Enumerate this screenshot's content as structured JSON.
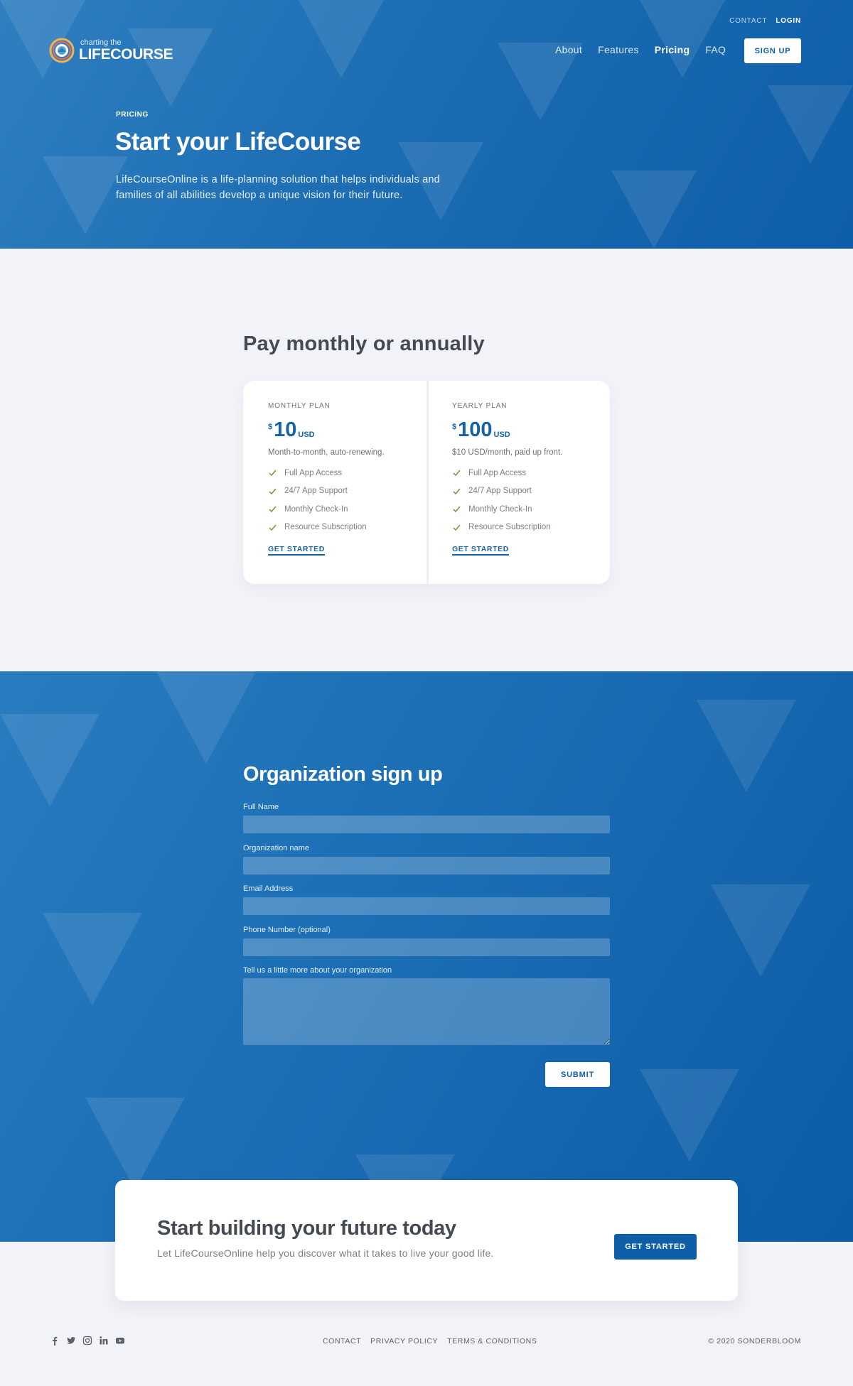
{
  "header": {
    "logo_small": "charting the",
    "logo_big": "LIFECOURSE",
    "top_links": {
      "contact": "CONTACT",
      "login": "LOGIN"
    },
    "nav": [
      {
        "label": "About"
      },
      {
        "label": "Features"
      },
      {
        "label": "Pricing",
        "active": true
      },
      {
        "label": "FAQ"
      }
    ],
    "signup_label": "SIGN UP"
  },
  "hero": {
    "eyebrow": "PRICING",
    "title": "Start your LifeCourse",
    "description": "LifeCourseOnline is a life-planning solution that helps individuals and families of all abilities develop a unique vision for their future."
  },
  "pricing": {
    "title": "Pay monthly or annually",
    "plans": [
      {
        "name": "MONTHLY PLAN",
        "currency_symbol": "$",
        "amount": "10",
        "unit": "USD",
        "description": "Month-to-month, auto-renewing.",
        "features": [
          "Full App Access",
          "24/7 App Support",
          "Monthly Check-In",
          "Resource Subscription"
        ],
        "cta": "GET STARTED"
      },
      {
        "name": "YEARLY PLAN",
        "currency_symbol": "$",
        "amount": "100",
        "unit": "USD",
        "description": "$10 USD/month, paid up front.",
        "features": [
          "Full App Access",
          "24/7 App Support",
          "Monthly Check-In",
          "Resource Subscription"
        ],
        "cta": "GET STARTED"
      }
    ]
  },
  "org_signup": {
    "title": "Organization sign up",
    "fields": [
      {
        "label": "Full Name",
        "value": ""
      },
      {
        "label": "Organization name",
        "value": ""
      },
      {
        "label": "Email Address",
        "value": ""
      },
      {
        "label": "Phone Number (optional)",
        "value": ""
      },
      {
        "label": "Tell us a little more about your organization",
        "value": ""
      }
    ],
    "submit_label": "SUBMIT"
  },
  "cta": {
    "title": "Start building your future today",
    "description": "Let LifeCourseOnline help you discover what it takes to live your good life.",
    "button_label": "GET STARTED"
  },
  "footer": {
    "social_icons": [
      "facebook-icon",
      "twitter-icon",
      "instagram-icon",
      "linkedin-icon",
      "youtube-icon"
    ],
    "links": [
      "CONTACT",
      "PRIVACY POLICY",
      "TERMS & CONDITIONS"
    ],
    "copyright": "© 2020 SONDERBLOOM"
  },
  "colors": {
    "brand_blue": "#1463a9",
    "hero_blue": "#1c6db3",
    "page_bg": "#f2f3f8",
    "check_green": "#6a9a3a"
  }
}
